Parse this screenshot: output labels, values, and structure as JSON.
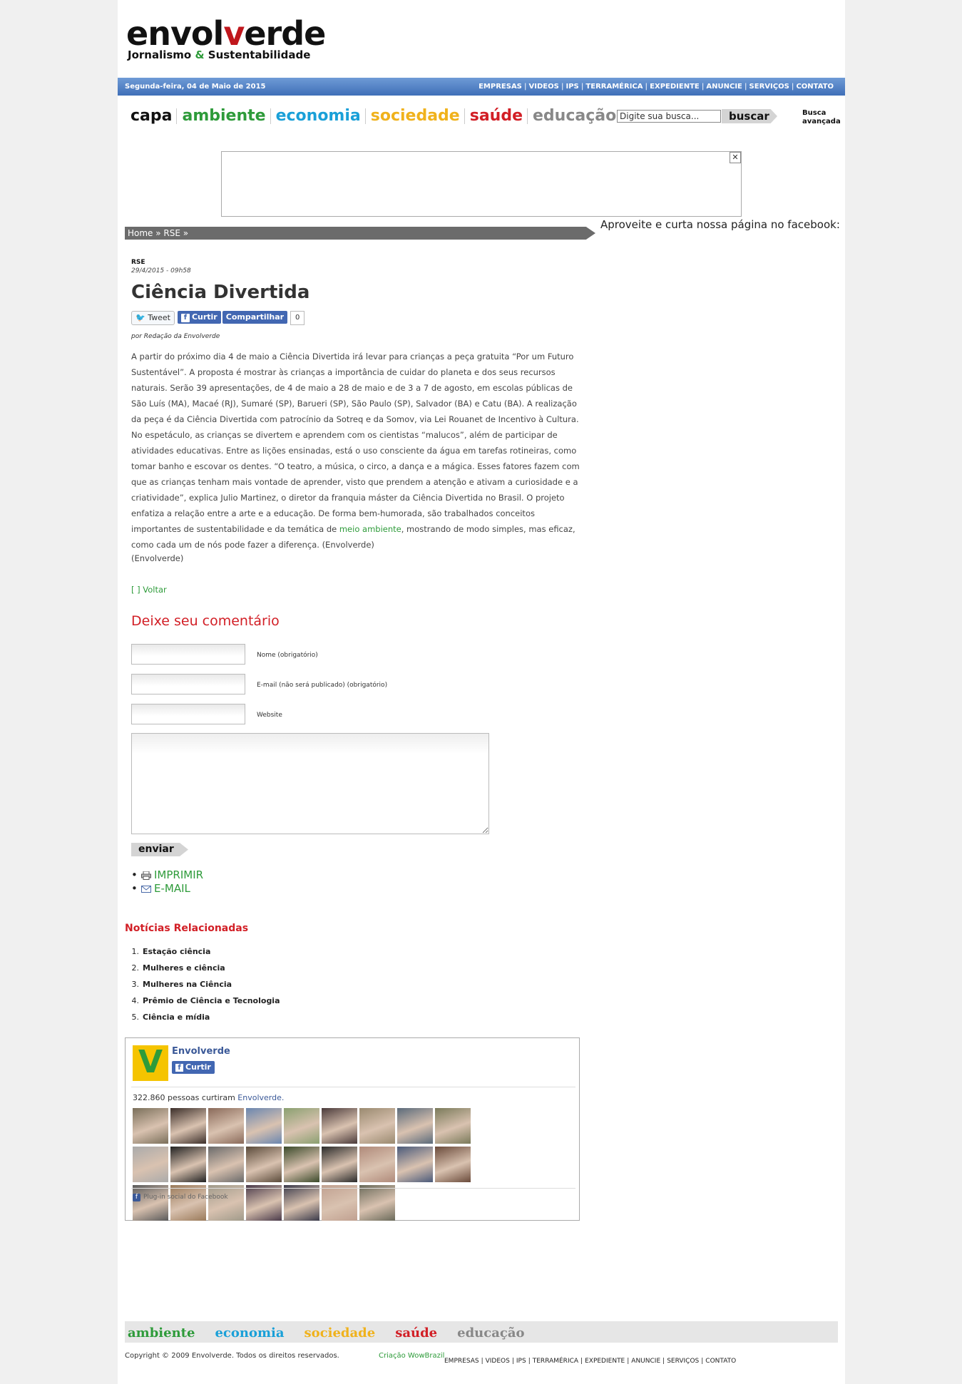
{
  "header": {
    "logo_text_a": "envol",
    "logo_text_v": "v",
    "logo_text_b": "erde",
    "tagline_a": "Jornalismo ",
    "tagline_amp": "&",
    "tagline_b": " Sustentabilidade"
  },
  "topbar": {
    "date": "Segunda-feira, 04 de Maio de 2015",
    "nav": [
      "EMPRESAS",
      "VIDEOS",
      "IPS",
      "TERRAMÉRICA",
      "EXPEDIENTE",
      "ANUNCIE",
      "SERVIÇOS",
      "CONTATO"
    ]
  },
  "categories": [
    {
      "label": "capa",
      "color": "#111111"
    },
    {
      "label": "ambiente",
      "color": "#2e9b3a"
    },
    {
      "label": "economia",
      "color": "#1aa0d8"
    },
    {
      "label": "sociedade",
      "color": "#f0b21c"
    },
    {
      "label": "saúde",
      "color": "#d21f26"
    },
    {
      "label": "educação",
      "color": "#888888"
    }
  ],
  "search": {
    "value": "Digite sua busca...",
    "button": "buscar",
    "advanced_1": "Busca",
    "advanced_2": "avançada"
  },
  "ad": {
    "close": "✕"
  },
  "breadcrumb": "Home » RSE »",
  "sidebar": {
    "facebook_prompt": "Aproveite e curta nossa página no facebook:"
  },
  "article": {
    "section": "RSE",
    "datetime": "29/4/2015 - 09h58",
    "title": "Ciência Divertida",
    "share": {
      "tweet": "Tweet",
      "like": "Curtir",
      "share": "Compartilhar",
      "count": "0"
    },
    "byline": "por Redação da Envolverde",
    "body_before_link": "A partir do próximo dia 4 de maio a Ciência Divertida irá levar para crianças a peça gratuita “Por um Futuro Sustentável”. A proposta é mostrar às crianças a importância de cuidar do planeta e dos seus recursos naturais. Serão 39 apresentações, de 4 de maio a 28 de maio e de 3 a 7 de agosto, em escolas públicas de São Luís (MA), Macaé (RJ), Sumaré (SP), Barueri (SP), São Paulo (SP), Salvador (BA) e Catu (BA). A realização da peça é da Ciência Divertida com patrocínio da Sotreq e da Somov, via Lei Rouanet de Incentivo à Cultura. No espetáculo, as crianças se divertem e aprendem com os cientistas “malucos”, além de participar de atividades educativas. Entre as lições ensinadas, está o uso consciente da água em tarefas rotineiras, como tomar banho e escovar os dentes. “O teatro, a música, o circo, a dança e a mágica. Esses fatores fazem com que as crianças tenham mais vontade de aprender, visto que prendem a atenção e ativam a curiosidade e a criatividade”, explica Julio Martinez, o diretor da franquia máster da Ciência Divertida no Brasil. O projeto enfatiza a relação entre a arte e a educação. De forma bem-humorada, são trabalhados conceitos importantes de sustentabilidade e da temática de ",
    "body_link": "meio ambiente",
    "body_after_link": ", mostrando de modo simples, mas eficaz, como cada um de nós pode fazer a diferença. (Envolverde)",
    "source": "(Envolverde)",
    "back": "[ ] Voltar"
  },
  "comment_form": {
    "heading": "Deixe seu comentário",
    "name_label": "Nome (obrigatório)",
    "email_label": "E-mail (não será publicado) (obrigatório)",
    "website_label": "Website",
    "submit": "enviar"
  },
  "tools": {
    "print": "IMPRIMIR",
    "email": "E-MAIL"
  },
  "related": {
    "heading": "Notícias Relacionadas",
    "items": [
      "Estação ciência",
      "Mulheres e ciência",
      "Mulheres na Ciência",
      "Prêmio de Ciência e Tecnologia",
      "Ciência e mídia"
    ]
  },
  "facebook_widget": {
    "page_name": "Envolverde",
    "like": "Curtir",
    "count_text": "322.860 pessoas curtiram ",
    "count_link": "Envolverde.",
    "plugin": "Plug-in social do Facebook",
    "logo_letter": "V",
    "face_colors": [
      "#7a6f5a",
      "#3c2f2a",
      "#8a6a5a",
      "#6a86b0",
      "#8aa070",
      "#4a3a3a",
      "#9a8a70",
      "#5a6a7a",
      "#7a7a5a",
      "#aaaaaa",
      "#222222",
      "#6a6a6a",
      "#5a4a3a",
      "#3a4a2a",
      "#2a2a2a",
      "#b08a7a",
      "#4a5a7a",
      "#6a4a3a",
      "#5a5a5a",
      "#9a7a5a",
      "#a09a8a",
      "#4a3a4a",
      "#3a3a4a",
      "#c0a090",
      "#6a6a5a"
    ]
  },
  "footer": {
    "categories": [
      {
        "label": "ambiente",
        "color": "#2e9b3a"
      },
      {
        "label": "economia",
        "color": "#1aa0d8"
      },
      {
        "label": "sociedade",
        "color": "#f0b21c"
      },
      {
        "label": "saúde",
        "color": "#d21f26"
      },
      {
        "label": "educação",
        "color": "#888888"
      }
    ],
    "copyright": "Copyright © 2009 Envolverde. Todos os direitos reservados.",
    "credit": "Criação WowBrazil",
    "nav": [
      "EMPRESAS",
      "VIDEOS",
      "IPS",
      "TERRAMÉRICA",
      "EXPEDIENTE",
      "ANUNCIE",
      "SERVIÇOS",
      "CONTATO"
    ]
  }
}
